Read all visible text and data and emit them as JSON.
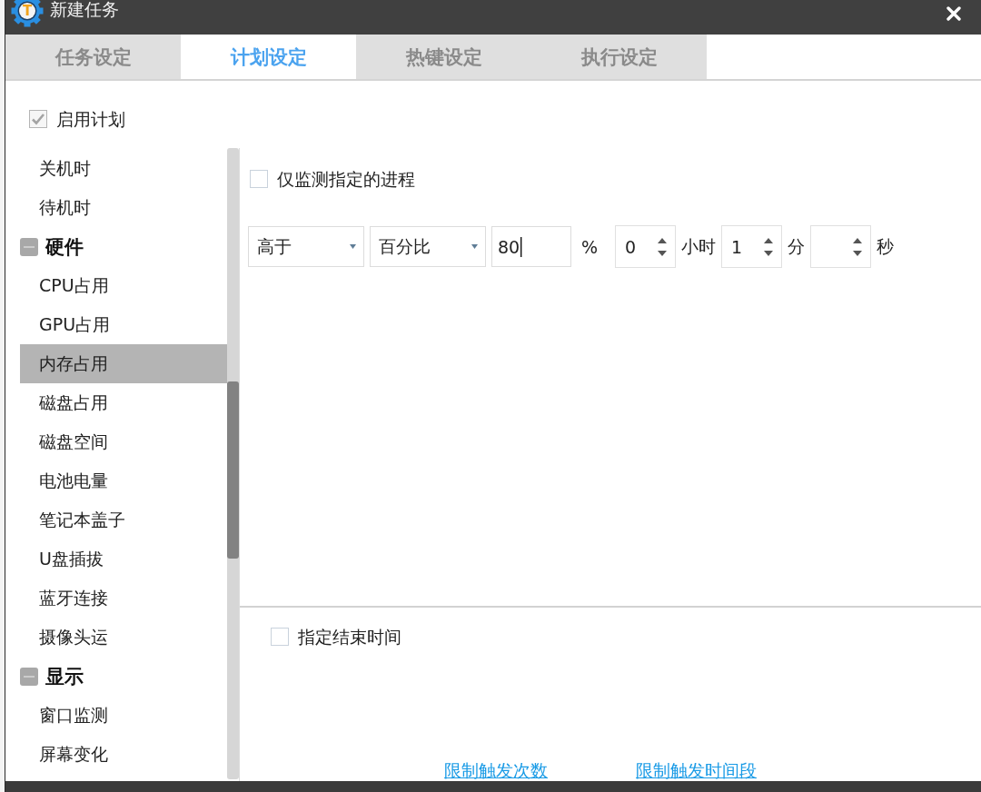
{
  "window": {
    "title": "新建任务",
    "logo_letter": "T"
  },
  "tabs": [
    {
      "label": "任务设定",
      "selected": false
    },
    {
      "label": "计划设定",
      "selected": true
    },
    {
      "label": "热键设定",
      "selected": false
    },
    {
      "label": "执行设定",
      "selected": false
    }
  ],
  "enable_schedule": {
    "label": "启用计划",
    "checked": true
  },
  "sidebar": {
    "items": [
      {
        "kind": "item",
        "label": "关机时",
        "selected": false
      },
      {
        "kind": "item",
        "label": "待机时",
        "selected": false
      },
      {
        "kind": "group",
        "label": "硬件",
        "expanded": true,
        "children": [
          {
            "label": "CPU占用",
            "selected": false
          },
          {
            "label": "GPU占用",
            "selected": false
          },
          {
            "label": "内存占用",
            "selected": true
          },
          {
            "label": "磁盘占用",
            "selected": false
          },
          {
            "label": "磁盘空间",
            "selected": false
          },
          {
            "label": "电池电量",
            "selected": false
          },
          {
            "label": "笔记本盖子",
            "selected": false
          },
          {
            "label": "U盘插拔",
            "selected": false
          },
          {
            "label": "蓝牙连接",
            "selected": false
          },
          {
            "label": "摄像头运",
            "selected": false
          }
        ]
      },
      {
        "kind": "group",
        "label": "显示",
        "expanded": true,
        "children": [
          {
            "label": "窗口监测",
            "selected": false
          },
          {
            "label": "屏幕变化",
            "selected": false
          }
        ]
      }
    ]
  },
  "condition": {
    "process_filter": {
      "label": "仅监测指定的进程",
      "checked": false
    },
    "comparison": {
      "value": "高于"
    },
    "unit": {
      "value": "百分比"
    },
    "threshold": {
      "value": "80",
      "focused": true
    },
    "threshold_unit": "%",
    "durations": [
      {
        "value": "0",
        "unit": "小时"
      },
      {
        "value": "1",
        "unit": "分"
      },
      {
        "unit": "秒"
      }
    ]
  },
  "end_time": {
    "label": "指定结束时间",
    "checked": false
  },
  "links": [
    "限制触发次数",
    "限制触发时间段"
  ]
}
